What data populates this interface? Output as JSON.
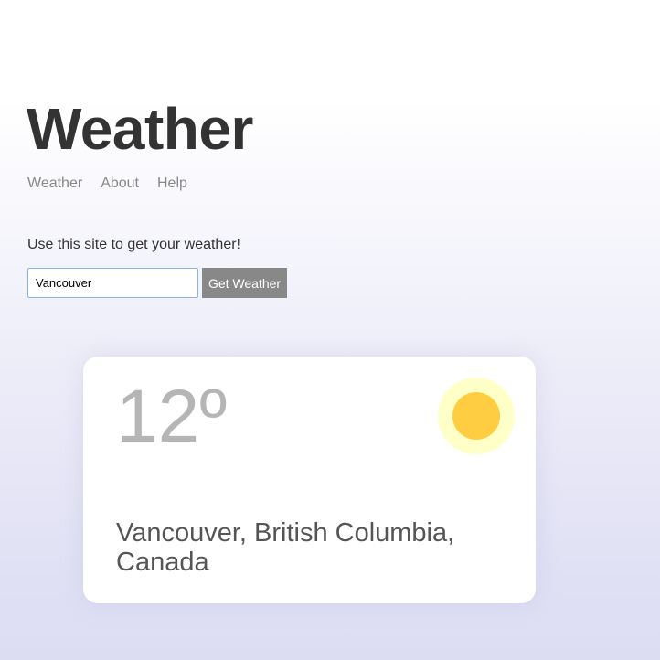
{
  "header": {
    "title": "Weather"
  },
  "nav": {
    "items": [
      {
        "label": "Weather"
      },
      {
        "label": "About"
      },
      {
        "label": "Help"
      }
    ]
  },
  "intro": {
    "text": "Use this site to get your weather!"
  },
  "search": {
    "value": "Vancouver",
    "placeholder": "",
    "button_label": "Get Weather"
  },
  "forecast": {
    "temperature": "12º",
    "icon": "sun-icon",
    "location": "Vancouver, British Columbia, Canada"
  },
  "colors": {
    "title_text": "#333333",
    "nav_text": "#888888",
    "button_bg": "#888888",
    "input_border": "#8ab4e8",
    "temperature_text": "#b5b5b5",
    "location_text": "#555555",
    "sun_halo": "#ffffc8",
    "sun_core": "#ffcd41"
  }
}
